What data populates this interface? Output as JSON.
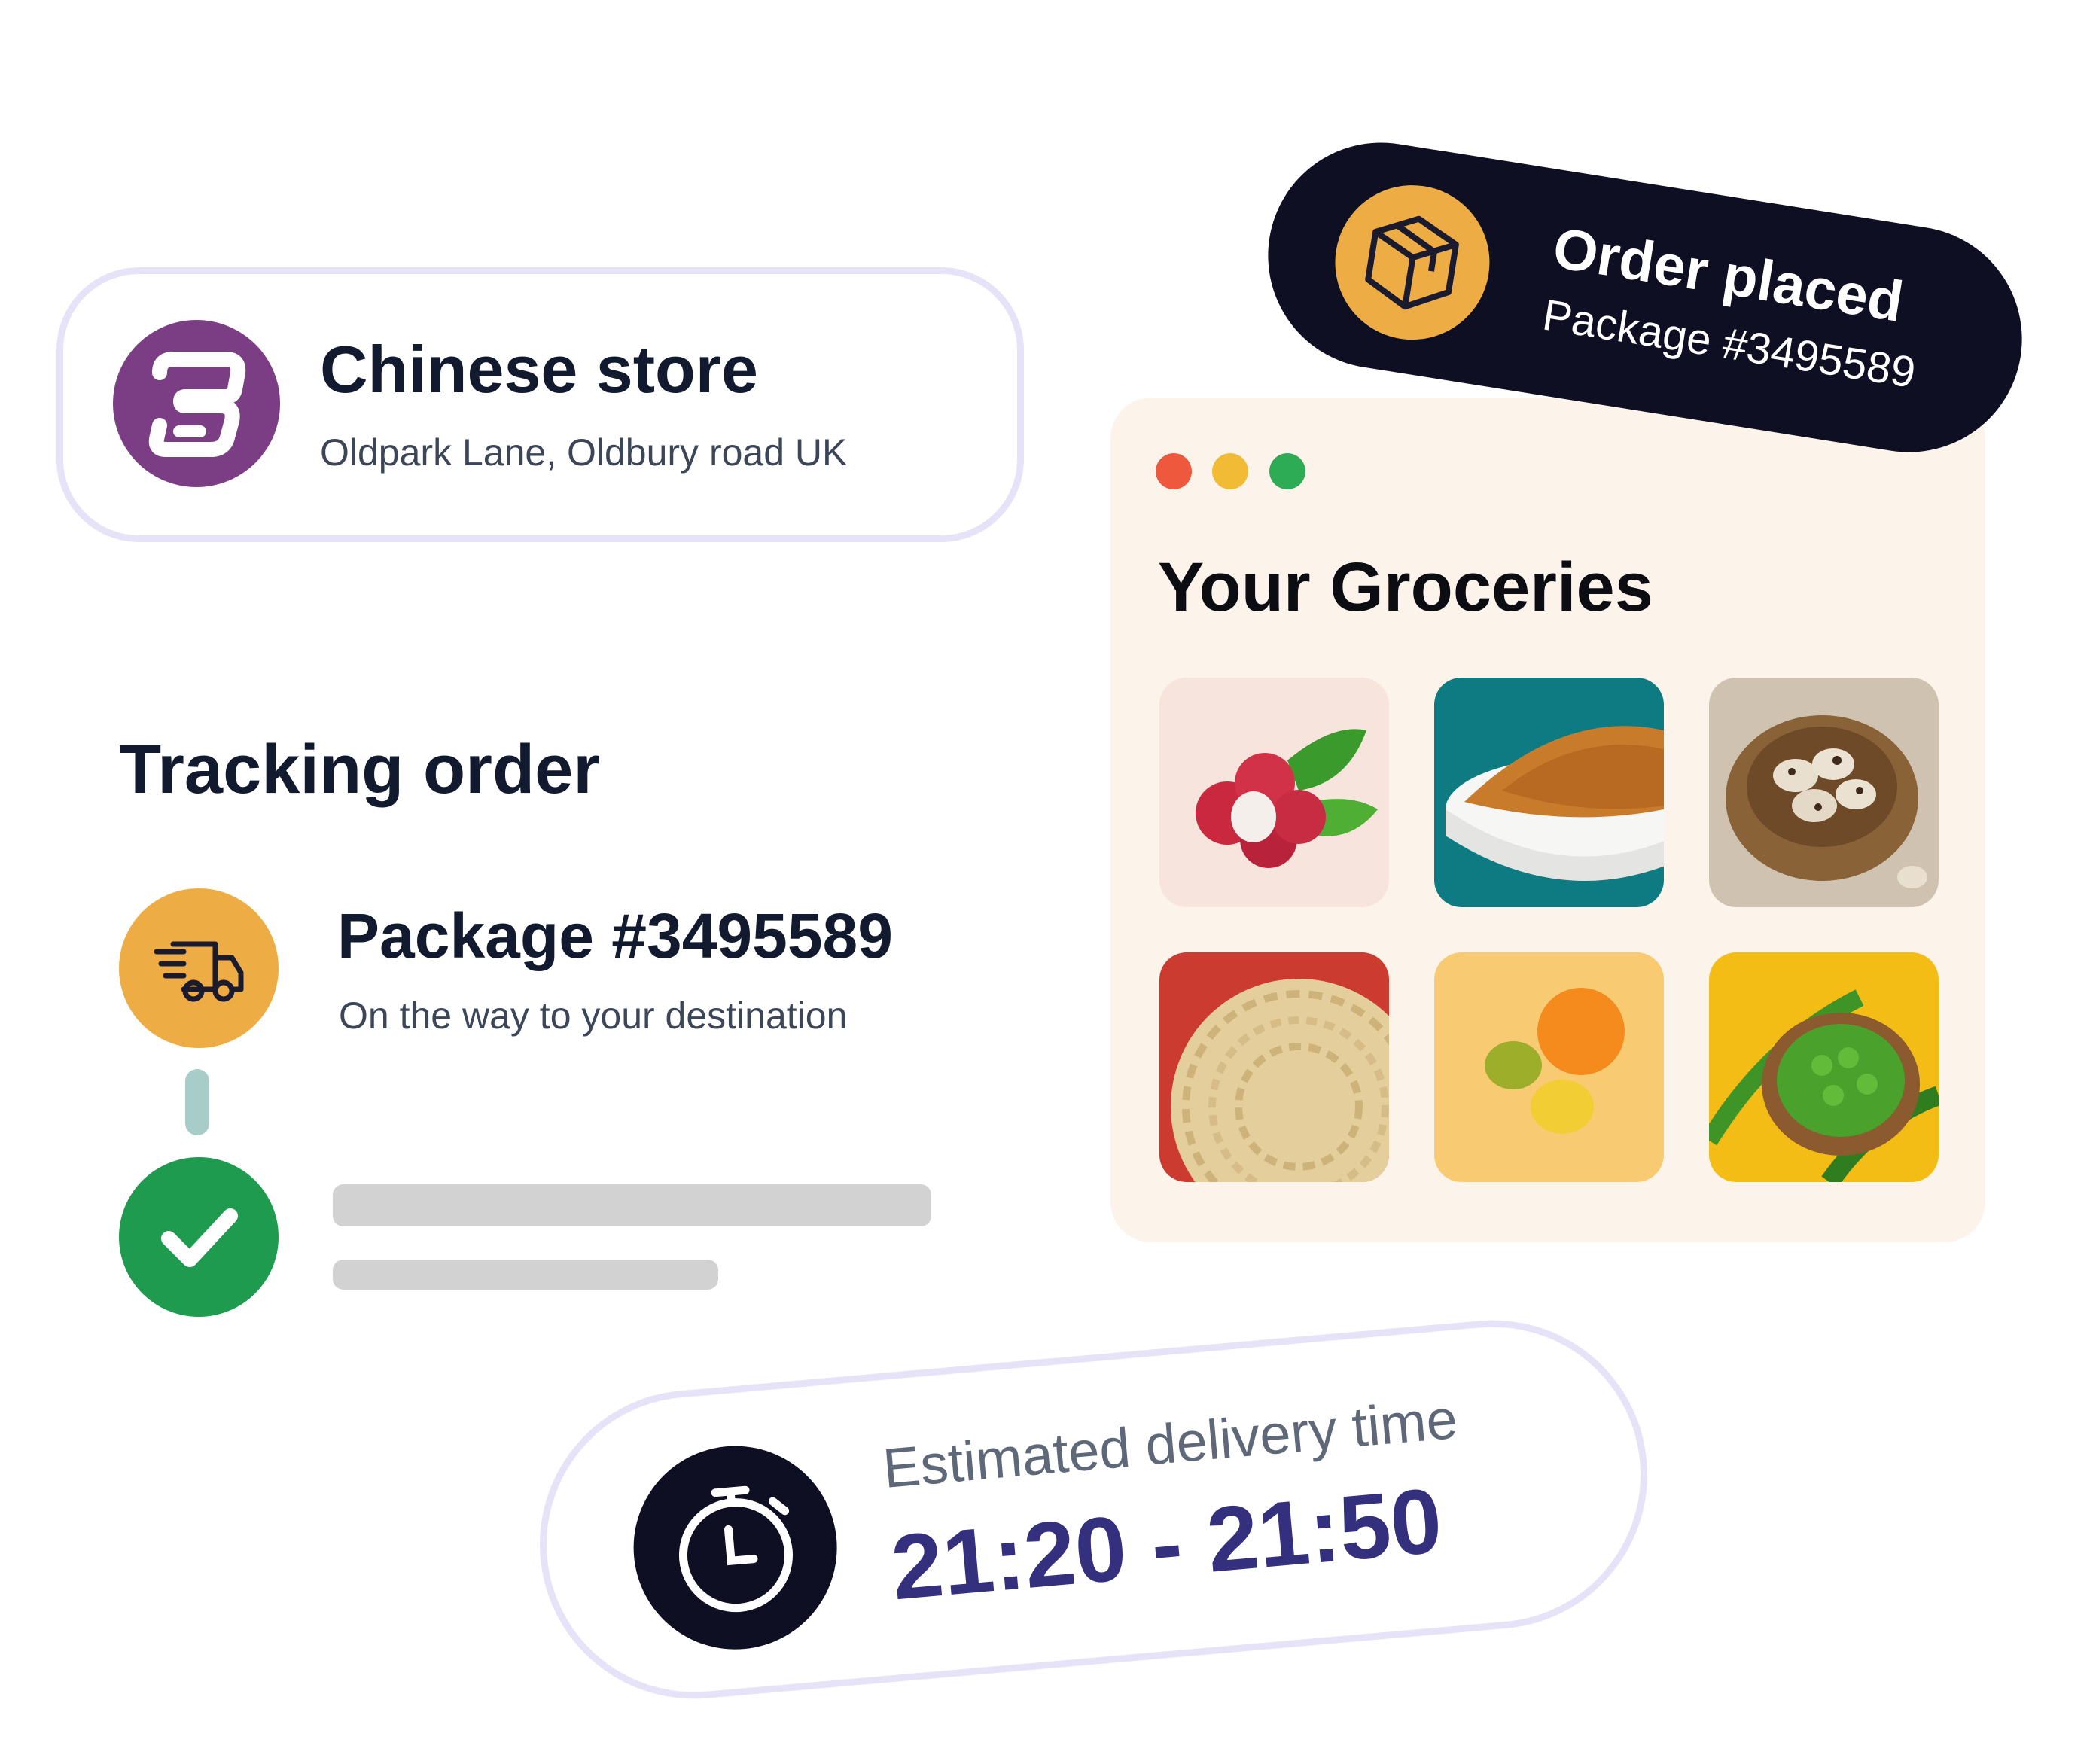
{
  "store": {
    "name": "Chinese store",
    "address": "Oldpark Lane, Oldbury road UK",
    "logo_icon": "store-logo-icon",
    "logo_color": "#7b3d84"
  },
  "tracking": {
    "title": "Tracking order",
    "package_title": "Package #3495589",
    "package_status": "On the way to your destination",
    "truck_icon": "delivery-truck-icon",
    "check_icon": "checkmark-icon",
    "accent_orange": "#eeac44",
    "accent_green": "#1f9b4f"
  },
  "order": {
    "title": "Order placed",
    "package": "Package #3495589",
    "icon": "package-box-icon"
  },
  "groceries": {
    "title": "Your Groceries",
    "window_dots": [
      "#ee583c",
      "#f2bb36",
      "#2eab55"
    ],
    "items": [
      {
        "name": "lychee-image"
      },
      {
        "name": "spice-powder-image"
      },
      {
        "name": "quail-eggs-image"
      },
      {
        "name": "noodles-image"
      },
      {
        "name": "citrus-fruits-image"
      },
      {
        "name": "green-peas-image"
      }
    ]
  },
  "delivery": {
    "label": "Estimated delivery time",
    "time": "21:20 - 21:50",
    "icon": "stopwatch-icon",
    "time_color": "#35307e"
  }
}
